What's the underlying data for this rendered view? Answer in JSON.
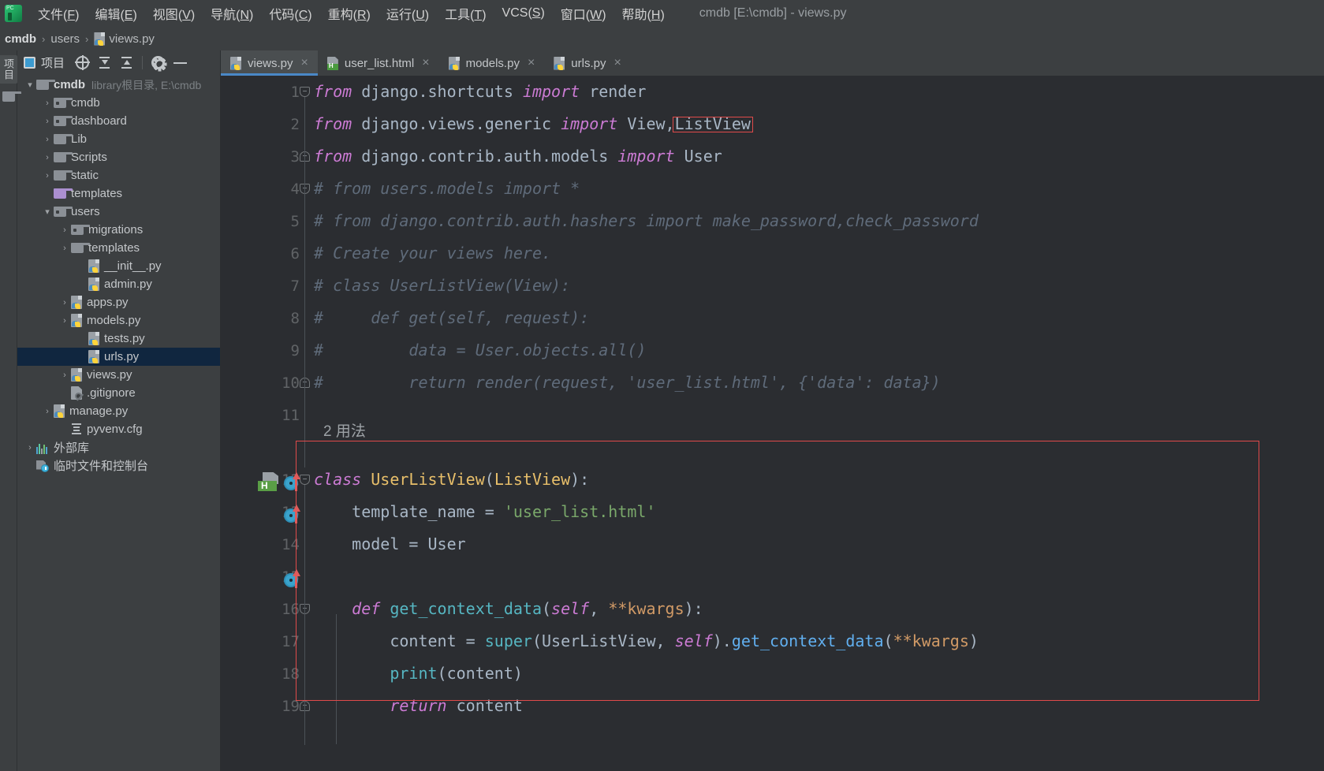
{
  "window": {
    "title": "cmdb [E:\\cmdb] - views.py",
    "app_icon": "pycharm-logo-icon"
  },
  "menu": {
    "items": [
      {
        "label": "文件",
        "accel": "F"
      },
      {
        "label": "编辑",
        "accel": "E"
      },
      {
        "label": "视图",
        "accel": "V"
      },
      {
        "label": "导航",
        "accel": "N"
      },
      {
        "label": "代码",
        "accel": "C"
      },
      {
        "label": "重构",
        "accel": "R"
      },
      {
        "label": "运行",
        "accel": "U"
      },
      {
        "label": "工具",
        "accel": "T"
      },
      {
        "label": "VCS",
        "accel": "S"
      },
      {
        "label": "窗口",
        "accel": "W"
      },
      {
        "label": "帮助",
        "accel": "H"
      }
    ]
  },
  "breadcrumb": {
    "items": [
      {
        "label": "cmdb",
        "icon": "none",
        "bold": true
      },
      {
        "label": "users",
        "icon": "none",
        "bold": false
      },
      {
        "label": "views.py",
        "icon": "python-file-icon",
        "bold": false
      }
    ],
    "separator": "›"
  },
  "toolstrip": {
    "vertical_tab_label": "项目",
    "folder_icon": "folder-icon"
  },
  "project_panel": {
    "title": "项目",
    "toolbar_icons": [
      {
        "name": "locate-target-icon"
      },
      {
        "name": "expand-all-icon"
      },
      {
        "name": "collapse-all-icon"
      },
      {
        "name": "settings-gear-icon"
      },
      {
        "name": "hide-panel-icon"
      }
    ],
    "tree": [
      {
        "label": "cmdb",
        "hint": "library根目录, E:\\cmdb",
        "indent": 0,
        "arrow": "down",
        "icon": "folder-icon",
        "selected": false,
        "bold": true
      },
      {
        "label": "cmdb",
        "hint": "",
        "indent": 1,
        "arrow": "right",
        "icon": "module-folder-icon",
        "selected": false,
        "bold": false
      },
      {
        "label": "dashboard",
        "hint": "",
        "indent": 1,
        "arrow": "right",
        "icon": "module-folder-icon",
        "selected": false,
        "bold": false
      },
      {
        "label": "Lib",
        "hint": "",
        "indent": 1,
        "arrow": "right",
        "icon": "folder-icon",
        "selected": false,
        "bold": false
      },
      {
        "label": "Scripts",
        "hint": "",
        "indent": 1,
        "arrow": "right",
        "icon": "folder-icon",
        "selected": false,
        "bold": false
      },
      {
        "label": "static",
        "hint": "",
        "indent": 1,
        "arrow": "right",
        "icon": "folder-icon",
        "selected": false,
        "bold": false
      },
      {
        "label": "templates",
        "hint": "",
        "indent": 1,
        "arrow": "none",
        "icon": "templates-folder-icon",
        "selected": false,
        "bold": false
      },
      {
        "label": "users",
        "hint": "",
        "indent": 1,
        "arrow": "down",
        "icon": "module-folder-icon",
        "selected": false,
        "bold": false
      },
      {
        "label": "migrations",
        "hint": "",
        "indent": 2,
        "arrow": "right",
        "icon": "module-folder-icon",
        "selected": false,
        "bold": false
      },
      {
        "label": "templates",
        "hint": "",
        "indent": 2,
        "arrow": "right",
        "icon": "folder-icon",
        "selected": false,
        "bold": false
      },
      {
        "label": "__init__.py",
        "hint": "",
        "indent": 3,
        "arrow": "none",
        "icon": "python-file-icon",
        "selected": false,
        "bold": false
      },
      {
        "label": "admin.py",
        "hint": "",
        "indent": 3,
        "arrow": "none",
        "icon": "python-file-icon",
        "selected": false,
        "bold": false
      },
      {
        "label": "apps.py",
        "hint": "",
        "indent": 2,
        "arrow": "right",
        "icon": "python-file-icon",
        "selected": false,
        "bold": false
      },
      {
        "label": "models.py",
        "hint": "",
        "indent": 2,
        "arrow": "right",
        "icon": "python-file-icon",
        "selected": false,
        "bold": false
      },
      {
        "label": "tests.py",
        "hint": "",
        "indent": 3,
        "arrow": "none",
        "icon": "python-file-icon",
        "selected": false,
        "bold": false
      },
      {
        "label": "urls.py",
        "hint": "",
        "indent": 3,
        "arrow": "none",
        "icon": "python-file-icon",
        "selected": true,
        "bold": false
      },
      {
        "label": "views.py",
        "hint": "",
        "indent": 2,
        "arrow": "right",
        "icon": "python-file-icon",
        "selected": false,
        "bold": false
      },
      {
        "label": ".gitignore",
        "hint": "",
        "indent": 2,
        "arrow": "none",
        "icon": "gitignore-file-icon",
        "selected": false,
        "bold": false
      },
      {
        "label": "manage.py",
        "hint": "",
        "indent": 1,
        "arrow": "right",
        "icon": "python-file-icon",
        "selected": false,
        "bold": false
      },
      {
        "label": "pyvenv.cfg",
        "hint": "",
        "indent": 2,
        "arrow": "none",
        "icon": "config-file-icon",
        "selected": false,
        "bold": false
      },
      {
        "label": "外部库",
        "hint": "",
        "indent": 0,
        "arrow": "right",
        "icon": "external-libraries-icon",
        "selected": false,
        "bold": false
      },
      {
        "label": "临时文件和控制台",
        "hint": "",
        "indent": 0,
        "arrow": "none",
        "icon": "scratches-consoles-icon",
        "selected": false,
        "bold": false
      }
    ]
  },
  "editor": {
    "tabs": [
      {
        "label": "views.py",
        "icon": "python-file-icon",
        "active": true,
        "close": "×"
      },
      {
        "label": "user_list.html",
        "icon": "html-file-icon",
        "active": false,
        "close": "×"
      },
      {
        "label": "models.py",
        "icon": "python-file-icon",
        "active": false,
        "close": "×"
      },
      {
        "label": "urls.py",
        "icon": "python-file-icon",
        "active": false,
        "close": "×"
      }
    ],
    "annotation": "2 用法",
    "highlight_word": "ListView",
    "lines": [
      {
        "num": "1",
        "text": "from django.shortcuts import render"
      },
      {
        "num": "2",
        "text": "from django.views.generic import View,ListView"
      },
      {
        "num": "3",
        "text": "from django.contrib.auth.models import User"
      },
      {
        "num": "4",
        "text": "# from users.models import *"
      },
      {
        "num": "5",
        "text": "# from django.contrib.auth.hashers import make_password,check_password"
      },
      {
        "num": "6",
        "text": "# Create your views here."
      },
      {
        "num": "7",
        "text": "# class UserListView(View):"
      },
      {
        "num": "8",
        "text": "#     def get(self, request):"
      },
      {
        "num": "9",
        "text": "#         data = User.objects.all()"
      },
      {
        "num": "10",
        "text": "#         return render(request, 'user_list.html', {'data': data})"
      },
      {
        "num": "11",
        "text": ""
      },
      {
        "num": "12",
        "text": "class UserListView(ListView):"
      },
      {
        "num": "13",
        "text": "    template_name = 'user_list.html'"
      },
      {
        "num": "14",
        "text": "    model = User"
      },
      {
        "num": "15",
        "text": ""
      },
      {
        "num": "16",
        "text": "    def get_context_data(self, **kwargs):"
      },
      {
        "num": "17",
        "text": "        content = super(UserListView, self).get_context_data(**kwargs)"
      },
      {
        "num": "18",
        "text": "        print(content)"
      },
      {
        "num": "19",
        "text": "        return content"
      }
    ],
    "gutter_markers": [
      {
        "line": "13",
        "icons": [
          "html-template-marker-icon",
          "related-item-icon",
          "override-arrow-icon"
        ]
      },
      {
        "line": "14",
        "icons": [
          "related-item-icon",
          "override-arrow-icon"
        ]
      },
      {
        "line": "16",
        "icons": [
          "related-item-icon",
          "override-arrow-icon"
        ]
      }
    ]
  },
  "colors": {
    "accent": "#4a88c7",
    "highlight_border": "#e04a4a",
    "selection": "#10263f",
    "editor_bg": "#2b2d31",
    "panel_bg": "#3c3f41"
  }
}
